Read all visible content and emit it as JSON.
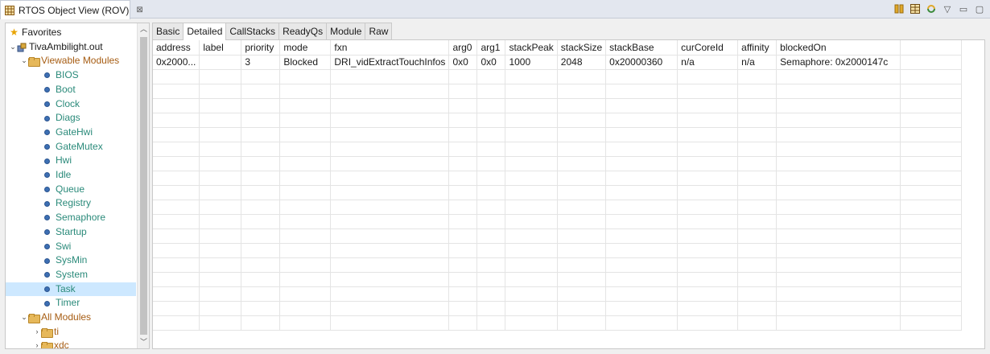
{
  "view": {
    "title": "RTOS Object View (ROV)",
    "close": "⊠"
  },
  "toolbar": {
    "items": [
      "pause-icon",
      "grid-icon",
      "refresh-icon",
      "view-menu-icon",
      "minimize-icon",
      "maximize-icon"
    ]
  },
  "tree": {
    "favorites": "Favorites",
    "app": "TivaAmbilight.out",
    "viewable_modules": "Viewable Modules",
    "modules": [
      "BIOS",
      "Boot",
      "Clock",
      "Diags",
      "GateHwi",
      "GateMutex",
      "Hwi",
      "Idle",
      "Queue",
      "Registry",
      "Semaphore",
      "Startup",
      "Swi",
      "SysMin",
      "System",
      "Task",
      "Timer"
    ],
    "selected": "Task",
    "all_modules": "All Modules",
    "packages": [
      "ti",
      "xdc"
    ]
  },
  "tabs": [
    "Basic",
    "Detailed",
    "CallStacks",
    "ReadyQs",
    "Module",
    "Raw"
  ],
  "active_tab": "Detailed",
  "table": {
    "columns": [
      "address",
      "label",
      "priority",
      "mode",
      "fxn",
      "arg0",
      "arg1",
      "stackPeak",
      "stackSize",
      "stackBase",
      "curCoreId",
      "affinity",
      "blockedOn"
    ],
    "rows": [
      [
        "0x2000...",
        "",
        "3",
        "Blocked",
        "DRI_vidExtractTouchInfos",
        "0x0",
        "0x0",
        "1000",
        "2048",
        "0x20000360",
        "n/a",
        "n/a",
        "Semaphore: 0x2000147c"
      ]
    ]
  }
}
